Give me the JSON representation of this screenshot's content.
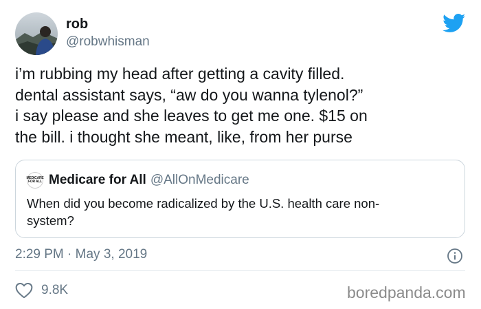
{
  "author": {
    "name": "rob",
    "handle": "@robwhisman",
    "avatar": "avatar-photo"
  },
  "tweet": {
    "lines": [
      "i’m rubbing my head after getting a cavity filled.",
      "dental assistant says, “aw do you wanna tylenol?”",
      "i say please and she leaves to get me one. $15 on",
      "the bill. i thought she meant, like, from her purse"
    ],
    "timestamp": "2:29 PM · May 3, 2019"
  },
  "quoted_tweet": {
    "avatar_text_1": "MEDICARE",
    "avatar_text_2": "FOR ALL",
    "name": "Medicare for All",
    "handle": "@AllOnMedicare",
    "lines": [
      "When did you become radicalized by the U.S. health care non-",
      "system?"
    ]
  },
  "actions": {
    "likes": "9.8K"
  },
  "watermark": "boredpanda.com",
  "colors": {
    "twitter_blue": "#1da1f2",
    "secondary_text": "#657786",
    "border": "#ccd6dd"
  },
  "icons": [
    "twitter-bird-icon",
    "info-icon",
    "heart-icon"
  ]
}
